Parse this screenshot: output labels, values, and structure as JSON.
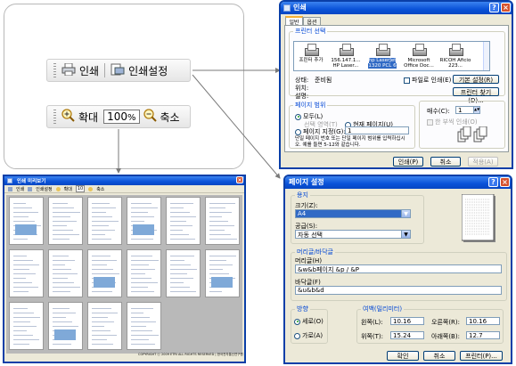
{
  "toolbar": {
    "print_label": "인쇄",
    "print_setup_label": "인쇄설정",
    "zoom_in_label": "확대",
    "zoom_value": "100",
    "zoom_unit": "%",
    "zoom_out_label": "축소"
  },
  "preview": {
    "title": "인쇄 미리보기",
    "print_label": "인쇄",
    "setup_label": "인쇄설정",
    "zoom_in_label": "확대",
    "zoom_value": "10",
    "zoom_out_label": "축소",
    "footer": "COPYRIGHT ⓒ 2009 ETRI ALL RIGHTS RESERVED | 한국전자통신연구원"
  },
  "print_dialog": {
    "title": "인쇄",
    "tab_general": "일반",
    "tab_options": "옵션",
    "printer_group": "프린터 선택",
    "printers": [
      "프린터 추가",
      "156.147.1... HP Laser...",
      "hp LaserJet 1320 PCL 6",
      "Microsoft Office Doc...",
      "RICOH Aficio 223..."
    ],
    "status_label": "상태:",
    "status_value": "준비됨",
    "location_label": "위치:",
    "comment_label": "설명:",
    "print_to_file": "파일로 인쇄(E)",
    "preferences_button": "기본 설정(R)",
    "find_printer_button": "프린터 찾기(D)...",
    "range_group": "페이지 범위",
    "range_all": "모두(L)",
    "range_selection": "선택 영역(T)",
    "range_current": "현재 페이지(U)",
    "range_pages": "페이지 지정(G):",
    "range_pages_value": "1",
    "range_hint": "단일 페이지 번호 또는 단일 페이지 범위를 입력하십시오. 예를 들면 5-12와 같습니다.",
    "copies_label": "매수(C):",
    "copies_value": "1",
    "collate_label": "한 부씩 인쇄(O)",
    "print_button": "인쇄(P)",
    "cancel_button": "취소",
    "apply_button": "적용(A)"
  },
  "page_setup": {
    "title": "페이지 설정",
    "paper_group": "용지",
    "size_label": "크기(Z):",
    "size_value": "A4",
    "source_label": "공급(S):",
    "source_value": "자동 선택",
    "header_group": "머리글/바닥글",
    "header_label": "머리글(H)",
    "header_value": "&w&b페이지 &p / &P",
    "footer_label": "바닥글(F)",
    "footer_value": "&u&b&d",
    "orientation_group": "방향",
    "portrait": "세로(O)",
    "landscape": "가로(A)",
    "margins_group": "여백(밀리미터)",
    "left_label": "왼쪽(L):",
    "left_value": "10.16",
    "right_label": "오른쪽(R):",
    "right_value": "10.16",
    "top_label": "위쪽(T):",
    "top_value": "15.24",
    "bottom_label": "아래쪽(B):",
    "bottom_value": "12.7",
    "ok_button": "확인",
    "cancel_button": "취소",
    "printer_button": "프린터(P)..."
  }
}
